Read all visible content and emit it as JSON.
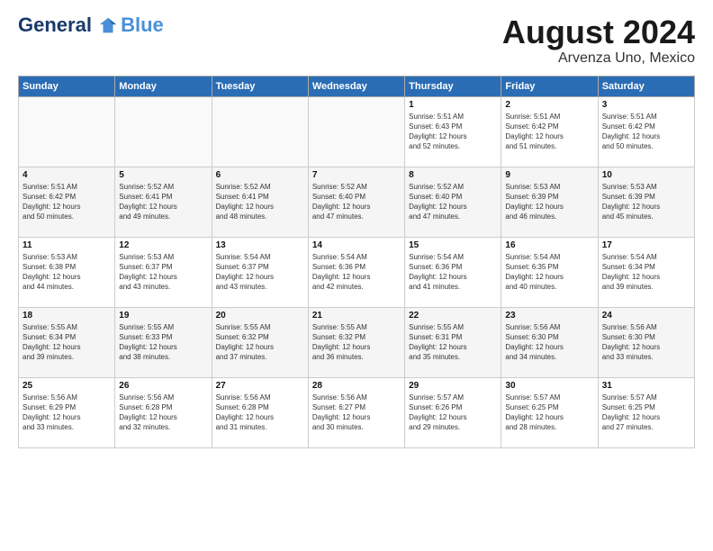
{
  "logo": {
    "line1": "General",
    "line2": "Blue"
  },
  "title": "August 2024",
  "location": "Arvenza Uno, Mexico",
  "days_header": [
    "Sunday",
    "Monday",
    "Tuesday",
    "Wednesday",
    "Thursday",
    "Friday",
    "Saturday"
  ],
  "weeks": [
    [
      {
        "day": "",
        "info": ""
      },
      {
        "day": "",
        "info": ""
      },
      {
        "day": "",
        "info": ""
      },
      {
        "day": "",
        "info": ""
      },
      {
        "day": "1",
        "info": "Sunrise: 5:51 AM\nSunset: 6:43 PM\nDaylight: 12 hours\nand 52 minutes."
      },
      {
        "day": "2",
        "info": "Sunrise: 5:51 AM\nSunset: 6:42 PM\nDaylight: 12 hours\nand 51 minutes."
      },
      {
        "day": "3",
        "info": "Sunrise: 5:51 AM\nSunset: 6:42 PM\nDaylight: 12 hours\nand 50 minutes."
      }
    ],
    [
      {
        "day": "4",
        "info": "Sunrise: 5:51 AM\nSunset: 6:42 PM\nDaylight: 12 hours\nand 50 minutes."
      },
      {
        "day": "5",
        "info": "Sunrise: 5:52 AM\nSunset: 6:41 PM\nDaylight: 12 hours\nand 49 minutes."
      },
      {
        "day": "6",
        "info": "Sunrise: 5:52 AM\nSunset: 6:41 PM\nDaylight: 12 hours\nand 48 minutes."
      },
      {
        "day": "7",
        "info": "Sunrise: 5:52 AM\nSunset: 6:40 PM\nDaylight: 12 hours\nand 47 minutes."
      },
      {
        "day": "8",
        "info": "Sunrise: 5:52 AM\nSunset: 6:40 PM\nDaylight: 12 hours\nand 47 minutes."
      },
      {
        "day": "9",
        "info": "Sunrise: 5:53 AM\nSunset: 6:39 PM\nDaylight: 12 hours\nand 46 minutes."
      },
      {
        "day": "10",
        "info": "Sunrise: 5:53 AM\nSunset: 6:39 PM\nDaylight: 12 hours\nand 45 minutes."
      }
    ],
    [
      {
        "day": "11",
        "info": "Sunrise: 5:53 AM\nSunset: 6:38 PM\nDaylight: 12 hours\nand 44 minutes."
      },
      {
        "day": "12",
        "info": "Sunrise: 5:53 AM\nSunset: 6:37 PM\nDaylight: 12 hours\nand 43 minutes."
      },
      {
        "day": "13",
        "info": "Sunrise: 5:54 AM\nSunset: 6:37 PM\nDaylight: 12 hours\nand 43 minutes."
      },
      {
        "day": "14",
        "info": "Sunrise: 5:54 AM\nSunset: 6:36 PM\nDaylight: 12 hours\nand 42 minutes."
      },
      {
        "day": "15",
        "info": "Sunrise: 5:54 AM\nSunset: 6:36 PM\nDaylight: 12 hours\nand 41 minutes."
      },
      {
        "day": "16",
        "info": "Sunrise: 5:54 AM\nSunset: 6:35 PM\nDaylight: 12 hours\nand 40 minutes."
      },
      {
        "day": "17",
        "info": "Sunrise: 5:54 AM\nSunset: 6:34 PM\nDaylight: 12 hours\nand 39 minutes."
      }
    ],
    [
      {
        "day": "18",
        "info": "Sunrise: 5:55 AM\nSunset: 6:34 PM\nDaylight: 12 hours\nand 39 minutes."
      },
      {
        "day": "19",
        "info": "Sunrise: 5:55 AM\nSunset: 6:33 PM\nDaylight: 12 hours\nand 38 minutes."
      },
      {
        "day": "20",
        "info": "Sunrise: 5:55 AM\nSunset: 6:32 PM\nDaylight: 12 hours\nand 37 minutes."
      },
      {
        "day": "21",
        "info": "Sunrise: 5:55 AM\nSunset: 6:32 PM\nDaylight: 12 hours\nand 36 minutes."
      },
      {
        "day": "22",
        "info": "Sunrise: 5:55 AM\nSunset: 6:31 PM\nDaylight: 12 hours\nand 35 minutes."
      },
      {
        "day": "23",
        "info": "Sunrise: 5:56 AM\nSunset: 6:30 PM\nDaylight: 12 hours\nand 34 minutes."
      },
      {
        "day": "24",
        "info": "Sunrise: 5:56 AM\nSunset: 6:30 PM\nDaylight: 12 hours\nand 33 minutes."
      }
    ],
    [
      {
        "day": "25",
        "info": "Sunrise: 5:56 AM\nSunset: 6:29 PM\nDaylight: 12 hours\nand 33 minutes."
      },
      {
        "day": "26",
        "info": "Sunrise: 5:56 AM\nSunset: 6:28 PM\nDaylight: 12 hours\nand 32 minutes."
      },
      {
        "day": "27",
        "info": "Sunrise: 5:56 AM\nSunset: 6:28 PM\nDaylight: 12 hours\nand 31 minutes."
      },
      {
        "day": "28",
        "info": "Sunrise: 5:56 AM\nSunset: 6:27 PM\nDaylight: 12 hours\nand 30 minutes."
      },
      {
        "day": "29",
        "info": "Sunrise: 5:57 AM\nSunset: 6:26 PM\nDaylight: 12 hours\nand 29 minutes."
      },
      {
        "day": "30",
        "info": "Sunrise: 5:57 AM\nSunset: 6:25 PM\nDaylight: 12 hours\nand 28 minutes."
      },
      {
        "day": "31",
        "info": "Sunrise: 5:57 AM\nSunset: 6:25 PM\nDaylight: 12 hours\nand 27 minutes."
      }
    ]
  ]
}
